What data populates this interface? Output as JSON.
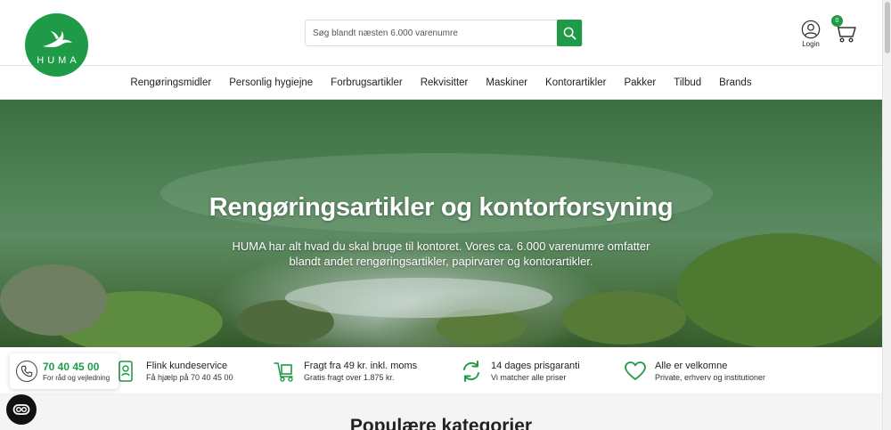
{
  "brand": {
    "name": "HUMA",
    "color": "#1f9a47"
  },
  "search": {
    "placeholder": "Søg blandt næsten 6.000 varenumre",
    "icon": "search-icon"
  },
  "account": {
    "login_label": "Login",
    "icon": "user-icon"
  },
  "cart": {
    "count": "0",
    "icon": "cart-icon"
  },
  "nav": {
    "items": [
      {
        "label": "Rengøringsmidler"
      },
      {
        "label": "Personlig hygiejne"
      },
      {
        "label": "Forbrugsartikler"
      },
      {
        "label": "Rekvisitter"
      },
      {
        "label": "Maskiner"
      },
      {
        "label": "Kontorartikler"
      },
      {
        "label": "Pakker"
      },
      {
        "label": "Tilbud"
      },
      {
        "label": "Brands"
      }
    ]
  },
  "hero": {
    "title": "Rengøringsartikler og kontorforsyning",
    "subtitle": "HUMA har alt hvad du skal bruge til kontoret. Vores ca. 6.000 varenumre omfatter blandt andet rengøringsartikler, papirvarer og kontorartikler."
  },
  "usps": [
    {
      "icon": "customer-service-icon",
      "title": "Flink kundeservice",
      "subtitle": "Få hjælp på 70 40 45 00"
    },
    {
      "icon": "delivery-icon",
      "title": "Fragt fra 49 kr. inkl. moms",
      "subtitle": "Gratis fragt over 1.875 kr."
    },
    {
      "icon": "recycle-arrows-icon",
      "title": "14 dages prisgaranti",
      "subtitle": "Vi matcher alle priser"
    },
    {
      "icon": "heart-icon",
      "title": "Alle er velkomne",
      "subtitle": "Private, erhverv og institutioner"
    }
  ],
  "phone_widget": {
    "number": "70 40 45 00",
    "subtitle": "For råd og vejledning",
    "icon": "phone-icon"
  },
  "accessibility": {
    "icon": "accessibility-icon"
  },
  "popular": {
    "title": "Populære kategorier"
  }
}
